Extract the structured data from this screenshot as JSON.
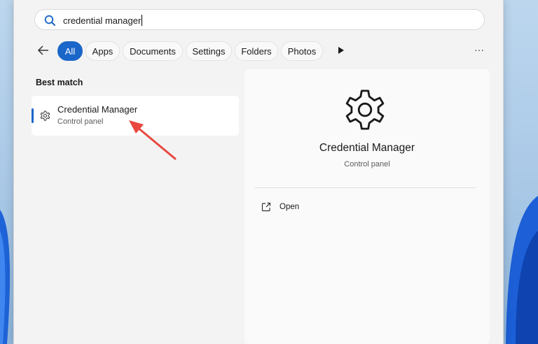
{
  "search": {
    "value": "credential manager"
  },
  "filters": [
    {
      "label": "All",
      "active": true
    },
    {
      "label": "Apps"
    },
    {
      "label": "Documents"
    },
    {
      "label": "Settings"
    },
    {
      "label": "Folders"
    },
    {
      "label": "Photos"
    }
  ],
  "overflow_label": "···",
  "results": {
    "section_label": "Best match",
    "best_match": {
      "title": "Credential Manager",
      "subtitle": "Control panel"
    }
  },
  "detail": {
    "title": "Credential Manager",
    "subtitle": "Control panel",
    "actions": [
      {
        "label": "Open",
        "icon": "open-external-icon"
      }
    ]
  },
  "icons": {
    "search": "search-icon",
    "back": "back-arrow-icon",
    "more_filters": "play-triangle-icon",
    "result": "gear-icon",
    "detail": "gear-icon"
  },
  "colors": {
    "accent": "#1a66c9",
    "annotation_arrow": "#e8483f"
  }
}
